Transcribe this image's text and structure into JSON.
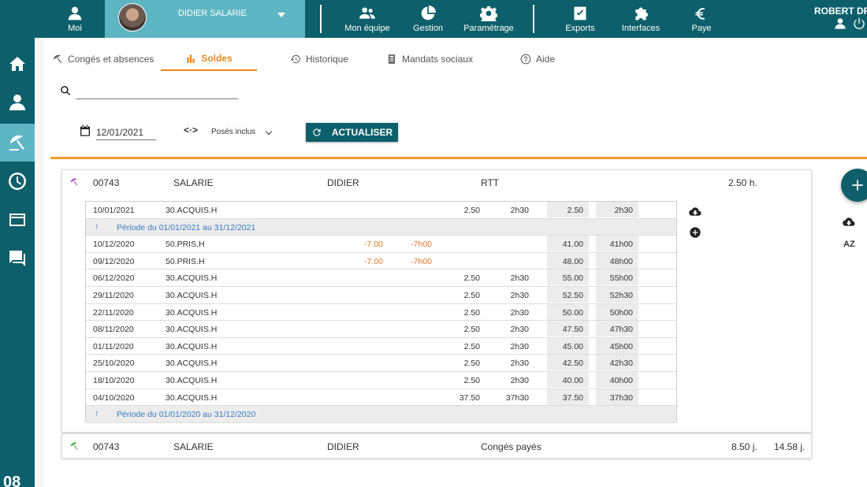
{
  "topbar": {
    "moi": "Moi",
    "user_name": "DIDIER SALARIE",
    "nav": [
      {
        "label": "Mon équipe",
        "icon": "team-icon"
      },
      {
        "label": "Gestion",
        "icon": "pie-chart-icon"
      },
      {
        "label": "Paramétrage",
        "icon": "gear-icon"
      },
      {
        "label": "Exports",
        "icon": "checklist-icon"
      },
      {
        "label": "Interfaces",
        "icon": "puzzle-icon"
      },
      {
        "label": "Paye",
        "icon": "euro-icon"
      }
    ],
    "current_user": "ROBERT DRI"
  },
  "sidebar": {
    "items": [
      "home-icon",
      "person-icon",
      "beach-umbrella-icon",
      "clock-icon",
      "card-icon",
      "chat-icon"
    ],
    "active_index": 2,
    "bottom_text": "08"
  },
  "tabs": [
    {
      "label": "Congés et absences",
      "icon": "umbrella-icon"
    },
    {
      "label": "Soldes",
      "icon": "bar-chart-icon"
    },
    {
      "label": "Historique",
      "icon": "history-icon"
    },
    {
      "label": "Mandats sociaux",
      "icon": "badge-icon"
    },
    {
      "label": "Aide",
      "icon": "help-icon"
    }
  ],
  "active_tab": 1,
  "search": {
    "value": "",
    "placeholder": ""
  },
  "filters": {
    "date": "12/01/2021",
    "range_icon": "<·>",
    "select_value": "Posés inclus",
    "refresh_label": "ACTUALISER"
  },
  "colors": {
    "primary": "#0d5f6b",
    "accent": "#5fb6c3",
    "orange": "#f39b2e",
    "link": "#3a7cc5",
    "negative": "#e8762a"
  },
  "card_rtt": {
    "matricule": "00743",
    "nom": "SALARIE",
    "prenom": "DIDIER",
    "type": "RTT",
    "solde": "2.50 h.",
    "rows": [
      {
        "kind": "row",
        "date": "10/01/2021",
        "code": "30.ACQUIS.H",
        "neg_days": "",
        "neg_hours": "",
        "acq_days": "2.50",
        "acq_hours": "2h30",
        "bal_days": "2.50",
        "bal_hours": "2h30"
      },
      {
        "kind": "period",
        "text": "Période du 01/01/2021 au 31/12/2021"
      },
      {
        "kind": "row",
        "date": "10/12/2020",
        "code": "50.PRIS.H",
        "neg_days": "-7.00",
        "neg_hours": "-7h00",
        "acq_days": "",
        "acq_hours": "",
        "bal_days": "41.00",
        "bal_hours": "41h00"
      },
      {
        "kind": "row",
        "date": "09/12/2020",
        "code": "50.PRIS.H",
        "neg_days": "-7.00",
        "neg_hours": "-7h00",
        "acq_days": "",
        "acq_hours": "",
        "bal_days": "48.00",
        "bal_hours": "48h00"
      },
      {
        "kind": "row",
        "date": "06/12/2020",
        "code": "30.ACQUIS.H",
        "neg_days": "",
        "neg_hours": "",
        "acq_days": "2.50",
        "acq_hours": "2h30",
        "bal_days": "55.00",
        "bal_hours": "55h00"
      },
      {
        "kind": "row",
        "date": "29/11/2020",
        "code": "30.ACQUIS.H",
        "neg_days": "",
        "neg_hours": "",
        "acq_days": "2.50",
        "acq_hours": "2h30",
        "bal_days": "52.50",
        "bal_hours": "52h30"
      },
      {
        "kind": "row",
        "date": "22/11/2020",
        "code": "30.ACQUIS.H",
        "neg_days": "",
        "neg_hours": "",
        "acq_days": "2.50",
        "acq_hours": "2h30",
        "bal_days": "50.00",
        "bal_hours": "50h00"
      },
      {
        "kind": "row",
        "date": "08/11/2020",
        "code": "30.ACQUIS.H",
        "neg_days": "",
        "neg_hours": "",
        "acq_days": "2.50",
        "acq_hours": "2h30",
        "bal_days": "47.50",
        "bal_hours": "47h30"
      },
      {
        "kind": "row",
        "date": "01/11/2020",
        "code": "30.ACQUIS.H",
        "neg_days": "",
        "neg_hours": "",
        "acq_days": "2.50",
        "acq_hours": "2h30",
        "bal_days": "45.00",
        "bal_hours": "45h00"
      },
      {
        "kind": "row",
        "date": "25/10/2020",
        "code": "30.ACQUIS.H",
        "neg_days": "",
        "neg_hours": "",
        "acq_days": "2.50",
        "acq_hours": "2h30",
        "bal_days": "42.50",
        "bal_hours": "42h30"
      },
      {
        "kind": "row",
        "date": "18/10/2020",
        "code": "30.ACQUIS.H",
        "neg_days": "",
        "neg_hours": "",
        "acq_days": "2.50",
        "acq_hours": "2h30",
        "bal_days": "40.00",
        "bal_hours": "40h00"
      },
      {
        "kind": "row",
        "date": "04/10/2020",
        "code": "30.ACQUIS.H",
        "neg_days": "",
        "neg_hours": "",
        "acq_days": "37.50",
        "acq_hours": "37h30",
        "bal_days": "37.50",
        "bal_hours": "37h30"
      },
      {
        "kind": "period",
        "text": "Période du 01/01/2020 au 31/12/2020"
      }
    ]
  },
  "card_cp": {
    "matricule": "00743",
    "nom": "SALARIE",
    "prenom": "DIDIER",
    "type": "Congés payés",
    "solde_days": "8.50 j.",
    "solde_total": "14.58 j."
  },
  "right_actions": {
    "add": "add-icon",
    "download": "cloud-download-icon",
    "sort_label": "AZ"
  }
}
